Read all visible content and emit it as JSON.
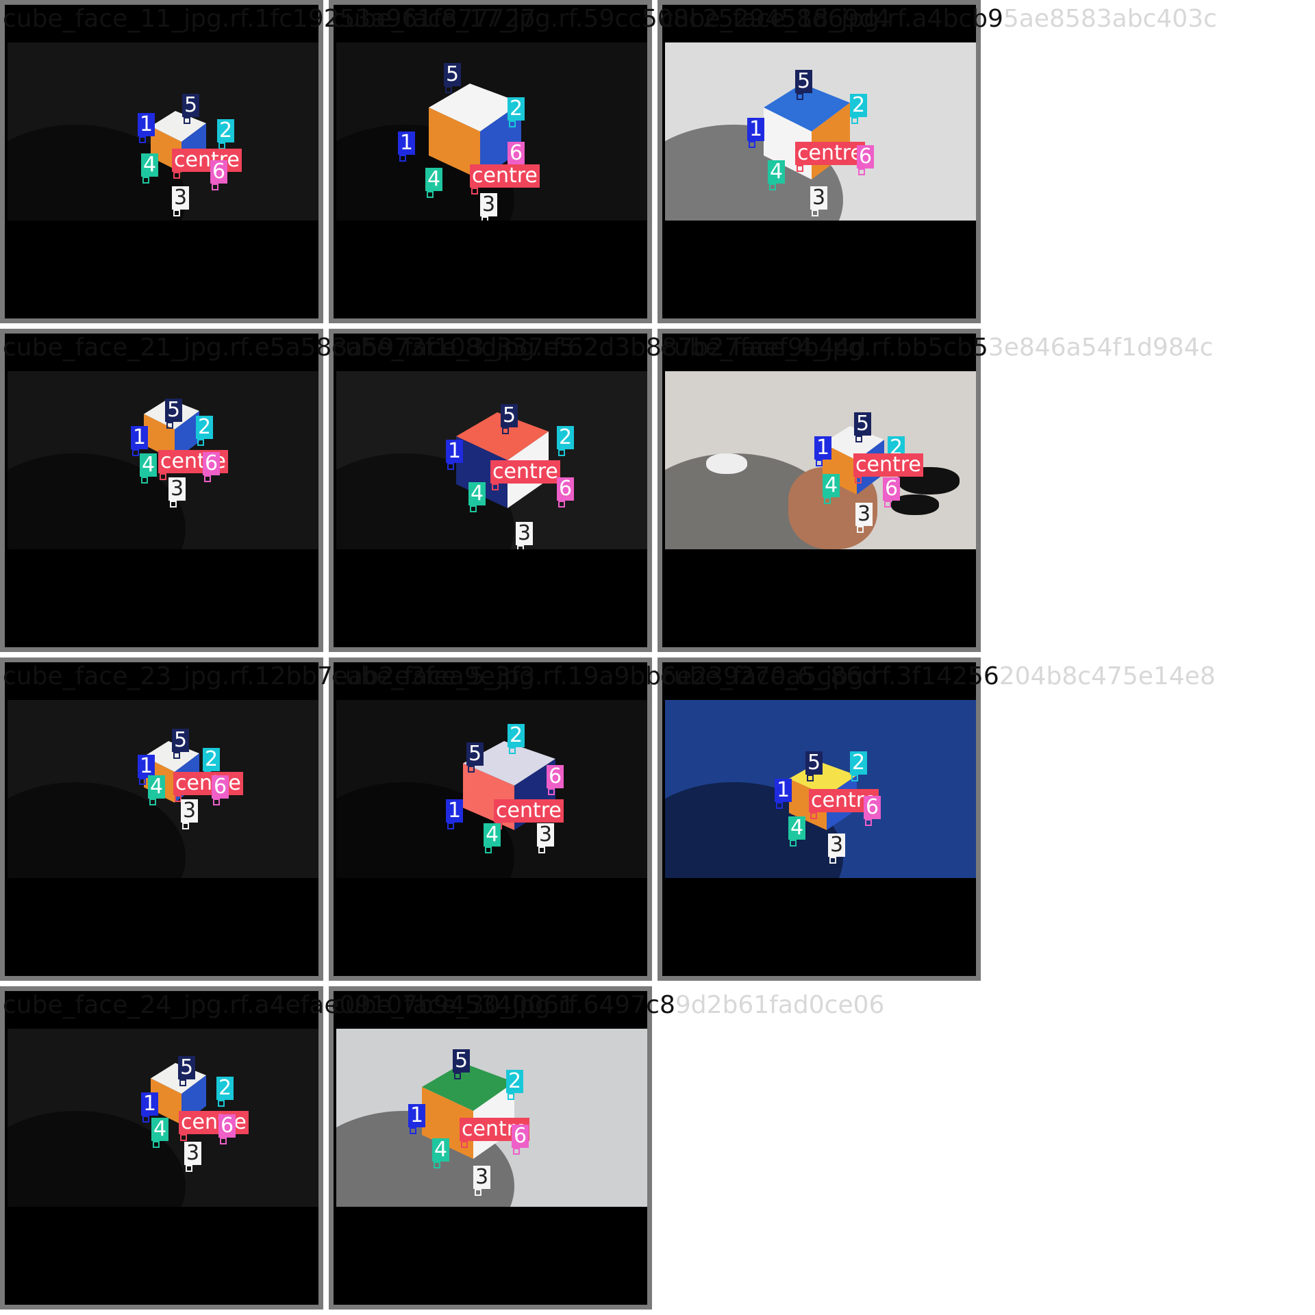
{
  "tiles": [
    {
      "title": "cube_face_11_jpg.rf.1fc19253a961f877727",
      "overflow": "",
      "scene": "desk"
    },
    {
      "title": "cube_face_17_jpg.rf.59cc508c2529458d69d4",
      "overflow": "",
      "scene": "stool"
    },
    {
      "title": "cube_face_18_jpg.rf.a4bcb9",
      "overflow": "5ae8583abc403c",
      "scene": "laptop"
    },
    {
      "title": "cube_face_21_jpg.rf.e5a583a5973f108d337e5",
      "overflow": "",
      "scene": "desk"
    },
    {
      "title": "cube_face_3_jpg.rf.62d3b887b27faef9b44d",
      "overflow": "",
      "scene": "stool-red"
    },
    {
      "title": "cube_face_4_jpg.rf.bb5cb5",
      "overflow": "3e846a54f1d984c",
      "scene": "floor"
    },
    {
      "title": "cube_face_23_jpg.rf.12bb7eab2e3fea9e3f3",
      "overflow": "",
      "scene": "desk"
    },
    {
      "title": "cube_face_5_jpg.rf.19a9bb6e239270a5c86d",
      "overflow": "",
      "scene": "stool-dark"
    },
    {
      "title": "cube_face_6_jpg.rf.3f14256",
      "overflow": "204b8c475e14e8",
      "scene": "blue"
    },
    {
      "title": "cube_face_24_jpg.rf.a4efae09107b945340061",
      "overflow": "",
      "scene": "desk"
    },
    {
      "title": "cube_face_30_jpg.rf.6497c8",
      "overflow": "9d2b61fad0ce06",
      "scene": "laptop-green"
    }
  ],
  "labels": {
    "one": "1",
    "two": "2",
    "three": "3",
    "four": "4",
    "five": "5",
    "six": "6",
    "centre": "centre"
  },
  "colors": {
    "label_1": "#1f2be0",
    "label_2": "#19c8d8",
    "label_3": "#f5f5f5",
    "label_4": "#1fc7a0",
    "label_5": "#19235e",
    "label_6": "#ee5fc8",
    "label_centre": "#f0445a"
  }
}
